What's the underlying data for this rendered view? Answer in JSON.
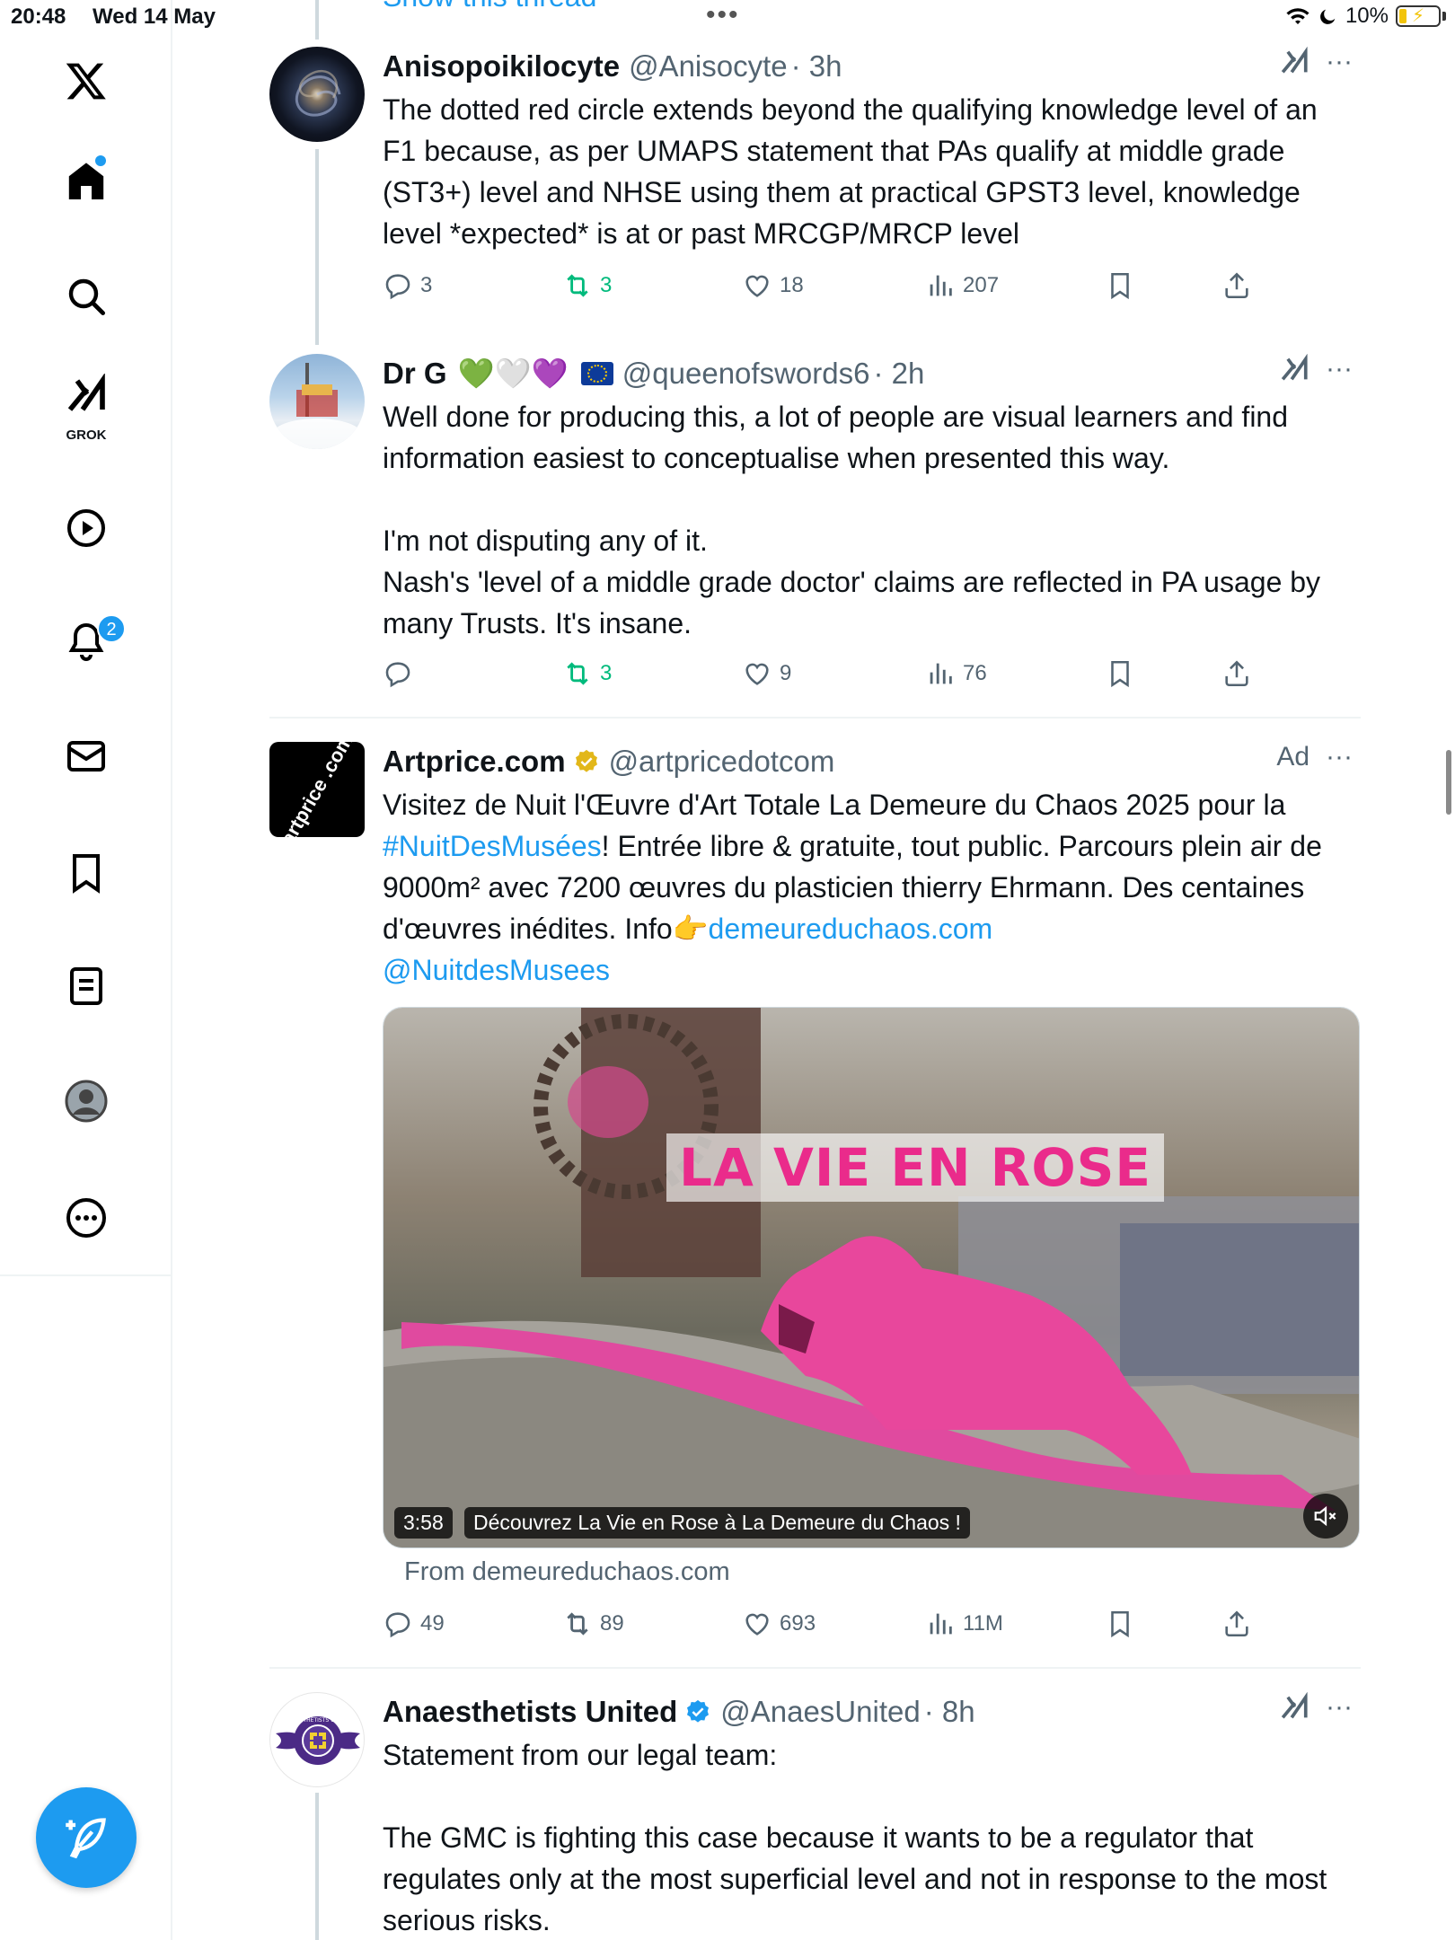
{
  "status_bar": {
    "time": "20:48",
    "date": "Wed 14 May",
    "battery": "10%"
  },
  "sidebar": {
    "grok_label": "GROK",
    "notifications_badge": "2"
  },
  "thread_header_partial": "Show this thread",
  "tweets": [
    {
      "name": "Anisopoikilocyte",
      "handle": "@Anisocyte",
      "time": "· 3h",
      "text": "The dotted red circle extends beyond the qualifying knowledge level of an F1 because, as per UMAPS statement that PAs qualify at middle grade (ST3+) level and NHSE using them at practical GPST3 level, knowledge level *expected* is at or past MRCGP/MRCP level",
      "replies": "3",
      "retweets": "3",
      "likes": "18",
      "views": "207"
    },
    {
      "name": "Dr G",
      "name_emojis": "💚🤍💜",
      "handle": "@queenofswords6",
      "time": "· 2h",
      "text_1": "Well done for producing this, a lot of people are visual learners and find information easiest to conceptualise when presented this way.",
      "text_2": "I'm not disputing any of it.\nNash's 'level of a middle grade doctor' claims are reflected in PA usage by many Trusts. It's insane.",
      "replies": "",
      "retweets": "3",
      "likes": "9",
      "views": "76"
    },
    {
      "name": "Artprice.com",
      "handle": "@artpricedotcom",
      "ad_label": "Ad",
      "text_a": "Visitez de Nuit l'Œuvre d'Art Totale La Demeure du Chaos 2025 pour la ",
      "hashtag": "#NuitDesMusées",
      "text_b": "! Entrée libre & gratuite, tout public. Parcours plein air de 9000m² avec 7200 œuvres du plasticien thierry Ehrmann. Des centaines d'œuvres inédites. Info👉",
      "link": "demeureduchaos.com",
      "mention": "@NuitdesMusees",
      "video_overlay": "LA VIE EN ROSE",
      "video_duration": "3:58",
      "video_caption": "Découvrez La Vie en Rose à La Demeure du Chaos !",
      "from": "From demeureduchaos.com",
      "replies": "49",
      "retweets": "89",
      "likes": "693",
      "views": "11M"
    },
    {
      "name": "Anaesthetists United",
      "handle": "@AnaesUnited",
      "time": "· 8h",
      "text_1": "Statement from our legal team:",
      "text_2": "The GMC is fighting this case because it wants to be a regulator that regulates only at the most superficial level and not in response to the most serious risks."
    }
  ],
  "avatar_labels": {
    "artprice": "artprice .com",
    "anaes": "ANAESTHETISTS UNITED"
  },
  "colors": {
    "accent": "#1d9bf0",
    "retweet_green": "#00ba7c",
    "muted": "#536471"
  }
}
